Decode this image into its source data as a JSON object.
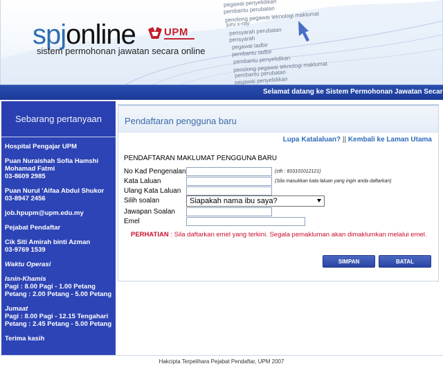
{
  "header": {
    "logo_spj": "spj",
    "logo_online": "online",
    "tagline": "sistem permohonan jawatan secara online",
    "upm_text": "UPM",
    "job_words": [
      "pegawai penyelidikan",
      "pembantu perubatan",
      "penolong pegawai teknologi maklumat",
      "juru x-ray",
      "pensyarah perubatan",
      "pensyarah",
      "pegawai tadbir",
      "pembantu tadbir",
      "pembantu penyelidikan",
      "penolong pegawai teknologi maklumat",
      "pembantu perubatan",
      "pegawai penyelidikan",
      "juru x-ray"
    ]
  },
  "welcome": "Selamat datang ke Sistem Permohonan Jawatan Secara Online",
  "sidebar": {
    "title": "Sebarang pertanyaan",
    "hospital": "Hospital Pengajar UPM",
    "contact1_name": "Puan Nuraishah Sofia Hamshi Mohamad Fatmi",
    "contact1_phone": "03-8609 2985",
    "contact2_name": "Puan Nurul 'Aifaa Abdul Shukor",
    "contact2_phone": "03-8947 2456",
    "email": "job.hpupm@upm.edu.my",
    "office": "Pejabat Pendaftar",
    "contact3_name": "Cik Siti Amirah binti Azman",
    "contact3_phone": "03-9769 1539",
    "hours_title": "Waktu Operasi",
    "weekday_title": "Isnin-Khamis",
    "weekday_hours": "Pagi : 8.00 Pagi - 1.00 Petang Petang : 2.00 Petang - 5.00 Petang",
    "friday_title": "Jumaat",
    "friday_hours": "Pagi : 8.00 Pagi - 12.15 Tengahari Petang : 2.45 Petang - 5.00 Petang",
    "thanks": "Terima kasih"
  },
  "main": {
    "title": "Pendaftaran pengguna baru",
    "link_forgot": "Lupa Katalaluan?",
    "link_sep": "||",
    "link_home": "Kembali ke Laman Utama",
    "form_heading": "PENDAFTARAN MAKLUMAT PENGGUNA BARU",
    "fields": {
      "ic_label": "No Kad Pengenalan",
      "ic_hint": "(cth : 810101012121)",
      "password_label": "Kata Laluan",
      "password_hint": "(Sila masukkan kata laluan yang ingin anda daftarkan)",
      "confirm_label": "Ulang Kata Laluan",
      "question_label": "Silih soalan",
      "question_value": "Siapakah nama ibu saya?",
      "answer_label": "Jawapan Soalan",
      "email_label": "Emel"
    },
    "notice_label": "PERHATIAN",
    "notice_text": " : Sila daftarkan emel yang terkini. Segala pemakluman akan dimaklumkan melalui emel.",
    "btn_save": "SIMPAN",
    "btn_cancel": "BATAL"
  },
  "footer": "Hakcipta Terpelihara Pejabat Pendaftar, UPM 2007",
  "colors": {
    "brand_blue": "#2e6db3",
    "sidebar_blue": "#2d44b6",
    "upm_red": "#c41e2b",
    "notice_red": "#c8102e"
  }
}
